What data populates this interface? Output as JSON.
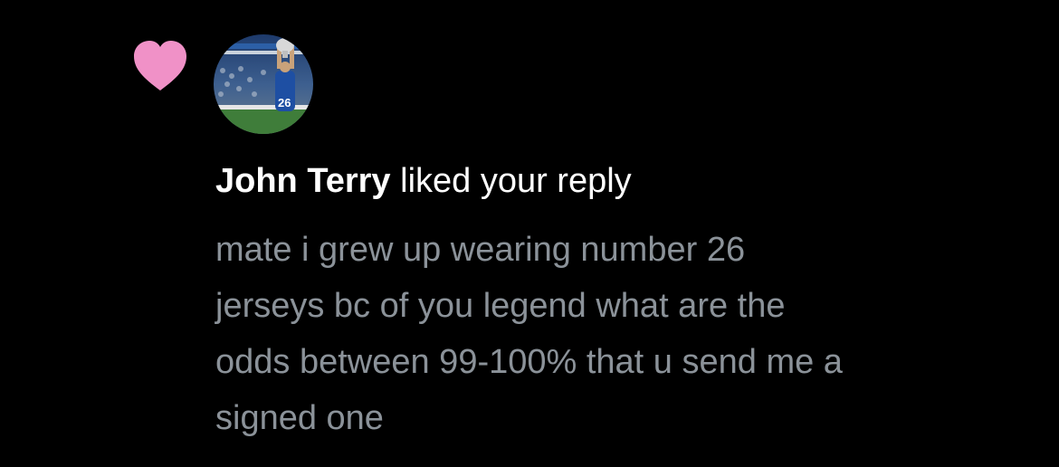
{
  "notification": {
    "type_icon": "heart-icon",
    "icon_color": "#f091c7",
    "avatar": "player-holding-trophy-avatar",
    "user_name": "John Terry",
    "action_text": " liked your reply",
    "reply_lines": [
      "mate i grew up wearing number 26",
      "jerseys bc of you legend what are the",
      "odds between 99-100% that u send me a",
      "signed one"
    ]
  },
  "colors": {
    "background": "#000000",
    "primary_text": "#ffffff",
    "secondary_text": "#8b9299",
    "heart": "#f091c7"
  }
}
